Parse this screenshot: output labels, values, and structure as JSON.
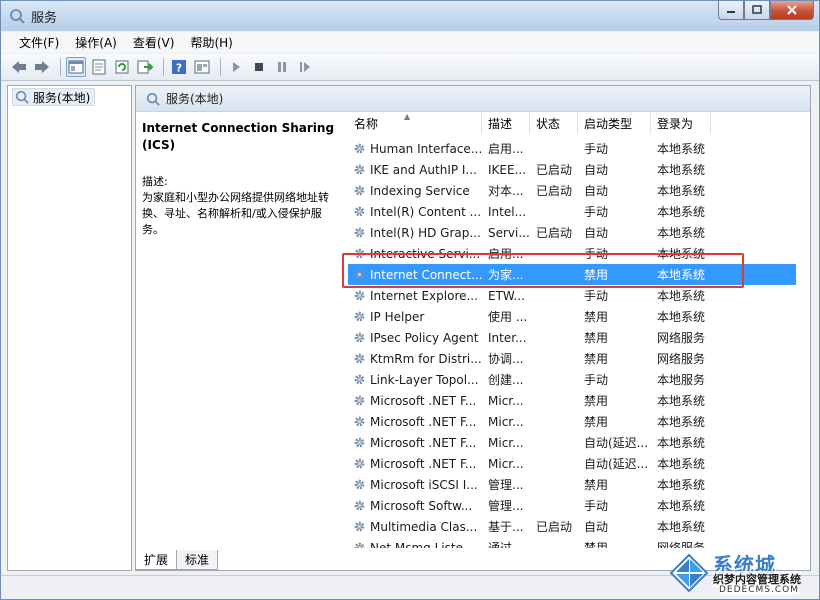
{
  "window": {
    "title": "服务"
  },
  "menu": [
    "文件(F)",
    "操作(A)",
    "查看(V)",
    "帮助(H)"
  ],
  "tree": {
    "item": "服务(本地)"
  },
  "pane": {
    "header": "服务(本地)"
  },
  "description": {
    "service_name": "Internet Connection Sharing (ICS)",
    "label": "描述:",
    "text": "为家庭和小型办公网络提供网络地址转换、寻址、名称解析和/或入侵保护服务。"
  },
  "columns": {
    "name": "名称",
    "desc": "描述",
    "status": "状态",
    "startup": "启动类型",
    "logon": "登录为"
  },
  "rows": [
    {
      "name": "Human Interface...",
      "desc": "启用...",
      "status": "",
      "startup": "手动",
      "logon": "本地系统"
    },
    {
      "name": "IKE and AuthIP I...",
      "desc": "IKEE...",
      "status": "已启动",
      "startup": "自动",
      "logon": "本地系统"
    },
    {
      "name": "Indexing Service",
      "desc": "对本...",
      "status": "已启动",
      "startup": "自动",
      "logon": "本地系统"
    },
    {
      "name": "Intel(R) Content ...",
      "desc": "Intel...",
      "status": "",
      "startup": "手动",
      "logon": "本地系统"
    },
    {
      "name": "Intel(R) HD Grap...",
      "desc": "Servi...",
      "status": "已启动",
      "startup": "自动",
      "logon": "本地系统"
    },
    {
      "name": "Interactive Servi...",
      "desc": "启用...",
      "status": "",
      "startup": "手动",
      "logon": "本地系统"
    },
    {
      "name": "Internet Connect...",
      "desc": "为家...",
      "status": "",
      "startup": "禁用",
      "logon": "本地系统"
    },
    {
      "name": "Internet Explore...",
      "desc": "ETW...",
      "status": "",
      "startup": "手动",
      "logon": "本地系统"
    },
    {
      "name": "IP Helper",
      "desc": "使用 ...",
      "status": "",
      "startup": "禁用",
      "logon": "本地系统"
    },
    {
      "name": "IPsec Policy Agent",
      "desc": "Inter...",
      "status": "",
      "startup": "禁用",
      "logon": "网络服务"
    },
    {
      "name": "KtmRm for Distri...",
      "desc": "协调...",
      "status": "",
      "startup": "禁用",
      "logon": "网络服务"
    },
    {
      "name": "Link-Layer Topol...",
      "desc": "创建...",
      "status": "",
      "startup": "手动",
      "logon": "本地服务"
    },
    {
      "name": "Microsoft .NET F...",
      "desc": "Micr...",
      "status": "",
      "startup": "禁用",
      "logon": "本地系统"
    },
    {
      "name": "Microsoft .NET F...",
      "desc": "Micr...",
      "status": "",
      "startup": "禁用",
      "logon": "本地系统"
    },
    {
      "name": "Microsoft .NET F...",
      "desc": "Micr...",
      "status": "",
      "startup": "自动(延迟...",
      "logon": "本地系统"
    },
    {
      "name": "Microsoft .NET F...",
      "desc": "Micr...",
      "status": "",
      "startup": "自动(延迟...",
      "logon": "本地系统"
    },
    {
      "name": "Microsoft iSCSI I...",
      "desc": "管理...",
      "status": "",
      "startup": "禁用",
      "logon": "本地系统"
    },
    {
      "name": "Microsoft Softw...",
      "desc": "管理...",
      "status": "",
      "startup": "手动",
      "logon": "本地系统"
    },
    {
      "name": "Multimedia Clas...",
      "desc": "基于...",
      "status": "已启动",
      "startup": "自动",
      "logon": "本地系统"
    },
    {
      "name": "Net Msmq Liste...",
      "desc": "通过...",
      "status": "",
      "startup": "禁用",
      "logon": "网络服务"
    }
  ],
  "tabs": [
    "扩展",
    "标准"
  ],
  "watermark": {
    "brand": "系统城",
    "sub": "织梦内容管理系统",
    "url": "DEDECMS.COM"
  },
  "colors": {
    "selection": "#3399ff",
    "highlight_box": "#d93a3a",
    "title_gradient_top": "#dbe8f6"
  },
  "icons": [
    "services-icon",
    "back-icon",
    "forward-icon",
    "up-icon",
    "show-tree-icon",
    "properties-icon",
    "refresh-icon",
    "export-icon",
    "help-icon",
    "view-icon",
    "play-icon",
    "stop-icon",
    "pause-icon",
    "restart-icon",
    "gear-icon"
  ]
}
